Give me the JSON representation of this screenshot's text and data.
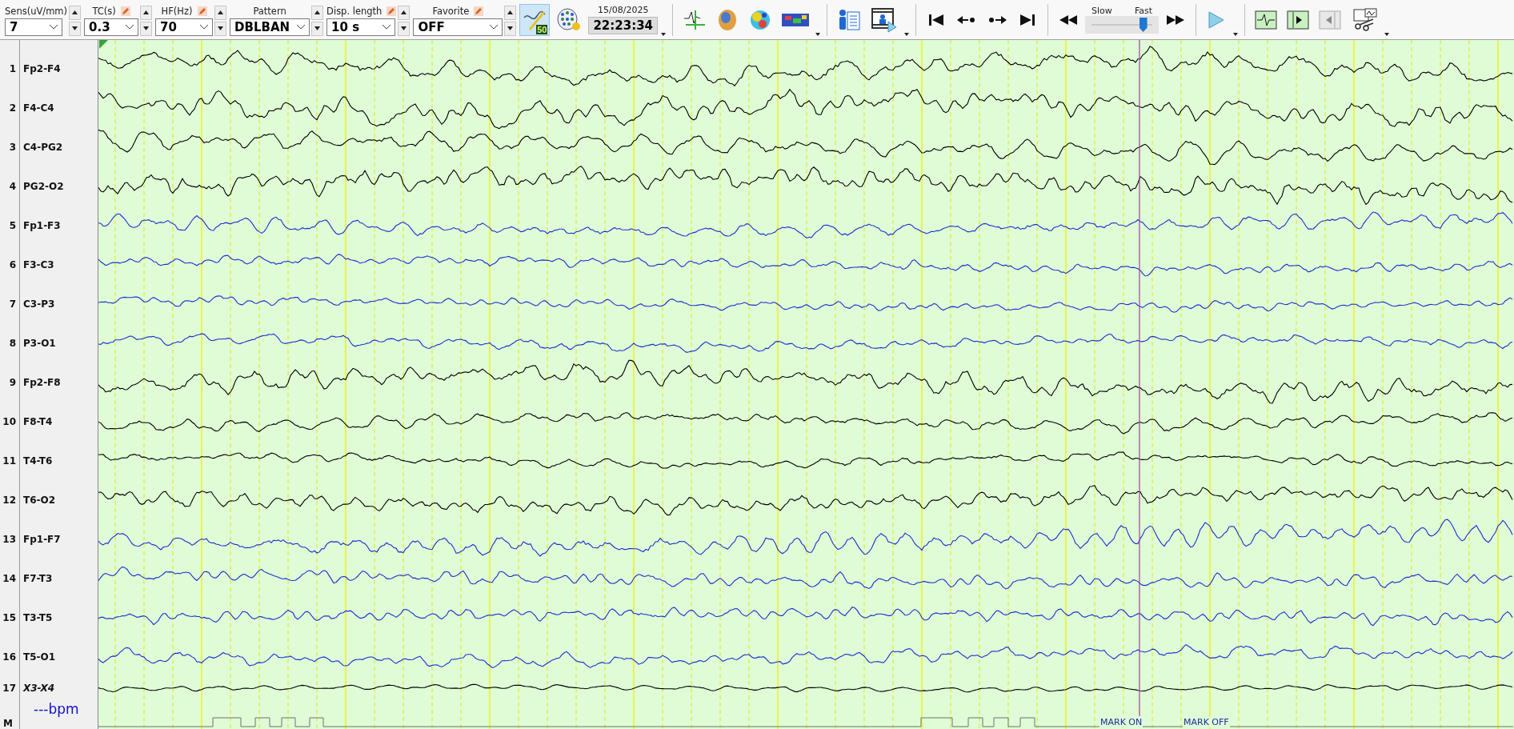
{
  "toolbar": {
    "controls": [
      {
        "label": "Sens(uV/mm)",
        "value": "7",
        "editable": false
      },
      {
        "label": "TC(s)",
        "value": "0.3",
        "editable": true
      },
      {
        "label": "HF(Hz)",
        "value": "70",
        "editable": true
      },
      {
        "label": "Pattern",
        "value": "DBLBAN",
        "editable": false
      },
      {
        "label": "Disp. length",
        "value": "10 s",
        "editable": true
      },
      {
        "label": "Favorite",
        "value": "OFF",
        "editable": true
      }
    ],
    "filter_button": {
      "value": "50",
      "active": true
    },
    "date": "15/08/2025",
    "time": "22:23:34",
    "speed": {
      "slow": "Slow",
      "fast": "Fast",
      "level": 0.85
    }
  },
  "channels": [
    {
      "number": "1",
      "name": "Fp2-F4",
      "color": "#000000",
      "kind": "eeg"
    },
    {
      "number": "2",
      "name": "F4-C4",
      "color": "#000000",
      "kind": "eeg"
    },
    {
      "number": "3",
      "name": "C4-PG2",
      "color": "#000000",
      "kind": "eeg"
    },
    {
      "number": "4",
      "name": "PG2-O2",
      "color": "#000000",
      "kind": "eeg"
    },
    {
      "number": "5",
      "name": "Fp1-F3",
      "color": "#1a2fd0",
      "kind": "eeg"
    },
    {
      "number": "6",
      "name": "F3-C3",
      "color": "#1a2fd0",
      "kind": "eeg"
    },
    {
      "number": "7",
      "name": "C3-P3",
      "color": "#1a2fd0",
      "kind": "eeg"
    },
    {
      "number": "8",
      "name": "P3-O1",
      "color": "#1a2fd0",
      "kind": "eeg"
    },
    {
      "number": "9",
      "name": "Fp2-F8",
      "color": "#000000",
      "kind": "eeg"
    },
    {
      "number": "10",
      "name": "F8-T4",
      "color": "#000000",
      "kind": "eeg"
    },
    {
      "number": "11",
      "name": "T4-T6",
      "color": "#000000",
      "kind": "eeg"
    },
    {
      "number": "12",
      "name": "T6-O2",
      "color": "#000000",
      "kind": "eeg"
    },
    {
      "number": "13",
      "name": "Fp1-F7",
      "color": "#1a2fd0",
      "kind": "eeg"
    },
    {
      "number": "14",
      "name": "F7-T3",
      "color": "#1a2fd0",
      "kind": "eeg"
    },
    {
      "number": "15",
      "name": "T3-T5",
      "color": "#1a2fd0",
      "kind": "eeg"
    },
    {
      "number": "16",
      "name": "T5-O1",
      "color": "#1a2fd0",
      "kind": "eeg"
    },
    {
      "number": "17",
      "name": "X3-X4",
      "color": "#000000",
      "kind": "aux"
    }
  ],
  "heart_rate": "---bpm",
  "marker_channel": "M",
  "marks": [
    {
      "label": "MARK ON"
    },
    {
      "label": "MARK OFF"
    }
  ]
}
